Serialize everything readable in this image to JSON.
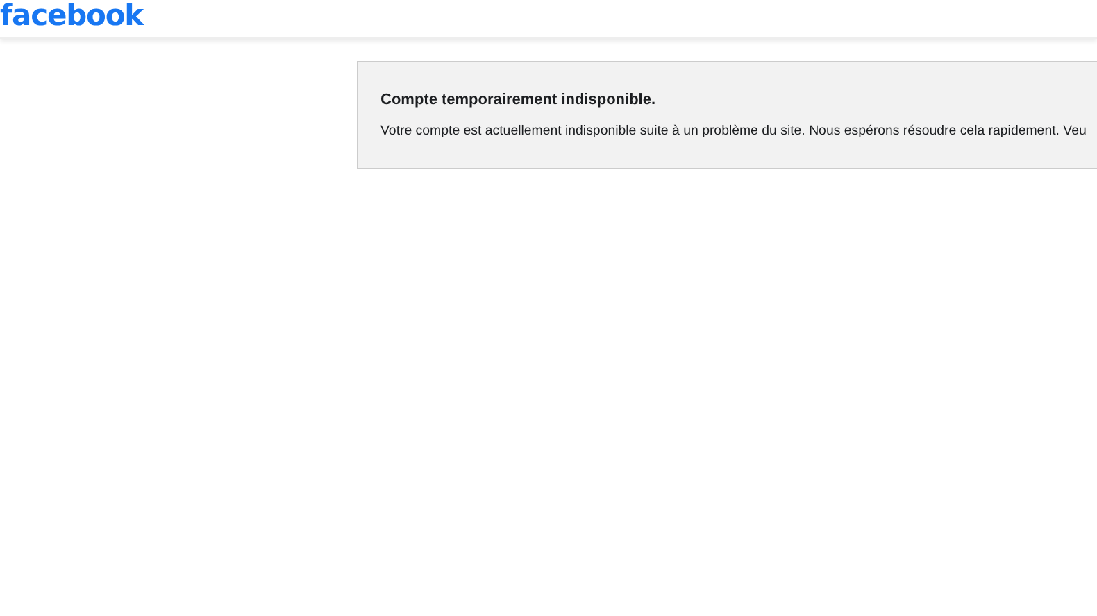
{
  "header": {
    "logo": "facebook"
  },
  "notice": {
    "title": "Compte temporairement indisponible.",
    "message": "Votre compte est actuellement indisponible suite à un problème du site. Nous espérons résoudre cela rapidement. Veu"
  }
}
